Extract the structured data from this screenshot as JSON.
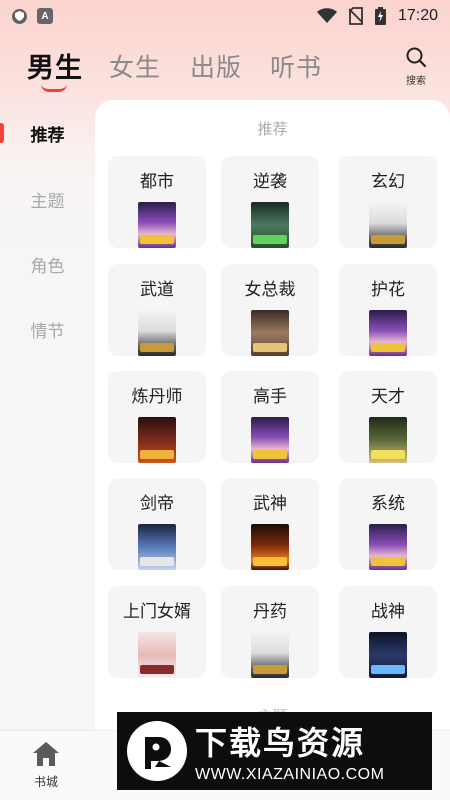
{
  "status_bar": {
    "time": "17:20"
  },
  "top_tabs": [
    {
      "label": "男生",
      "active": true
    },
    {
      "label": "女生",
      "active": false
    },
    {
      "label": "出版",
      "active": false
    },
    {
      "label": "听书",
      "active": false
    }
  ],
  "search": {
    "label": "搜索"
  },
  "side_nav": [
    {
      "label": "推荐",
      "active": true
    },
    {
      "label": "主题",
      "active": false
    },
    {
      "label": "角色",
      "active": false
    },
    {
      "label": "情节",
      "active": false
    }
  ],
  "section": {
    "title": "推荐",
    "next_title": "主题"
  },
  "categories": [
    {
      "label": "都市",
      "cover": "purple"
    },
    {
      "label": "逆袭",
      "cover": "green"
    },
    {
      "label": "玄幻",
      "cover": "white"
    },
    {
      "label": "武道",
      "cover": "white"
    },
    {
      "label": "女总裁",
      "cover": "brown"
    },
    {
      "label": "护花",
      "cover": "purple"
    },
    {
      "label": "炼丹师",
      "cover": "darkred"
    },
    {
      "label": "高手",
      "cover": "purple"
    },
    {
      "label": "天才",
      "cover": "olive"
    },
    {
      "label": "剑帝",
      "cover": "slate"
    },
    {
      "label": "武神",
      "cover": "fire"
    },
    {
      "label": "系统",
      "cover": "purple"
    },
    {
      "label": "上门女婿",
      "cover": "pink"
    },
    {
      "label": "丹药",
      "cover": "white"
    },
    {
      "label": "战神",
      "cover": "navy"
    }
  ],
  "bottom_nav": {
    "home_label": "书城"
  },
  "watermark": {
    "title": "下载鸟资源",
    "url": "WWW.XIAZAINIAO.COM"
  },
  "colors": {
    "accent": "#f2403c",
    "card_bg": "#f5f5f5"
  }
}
